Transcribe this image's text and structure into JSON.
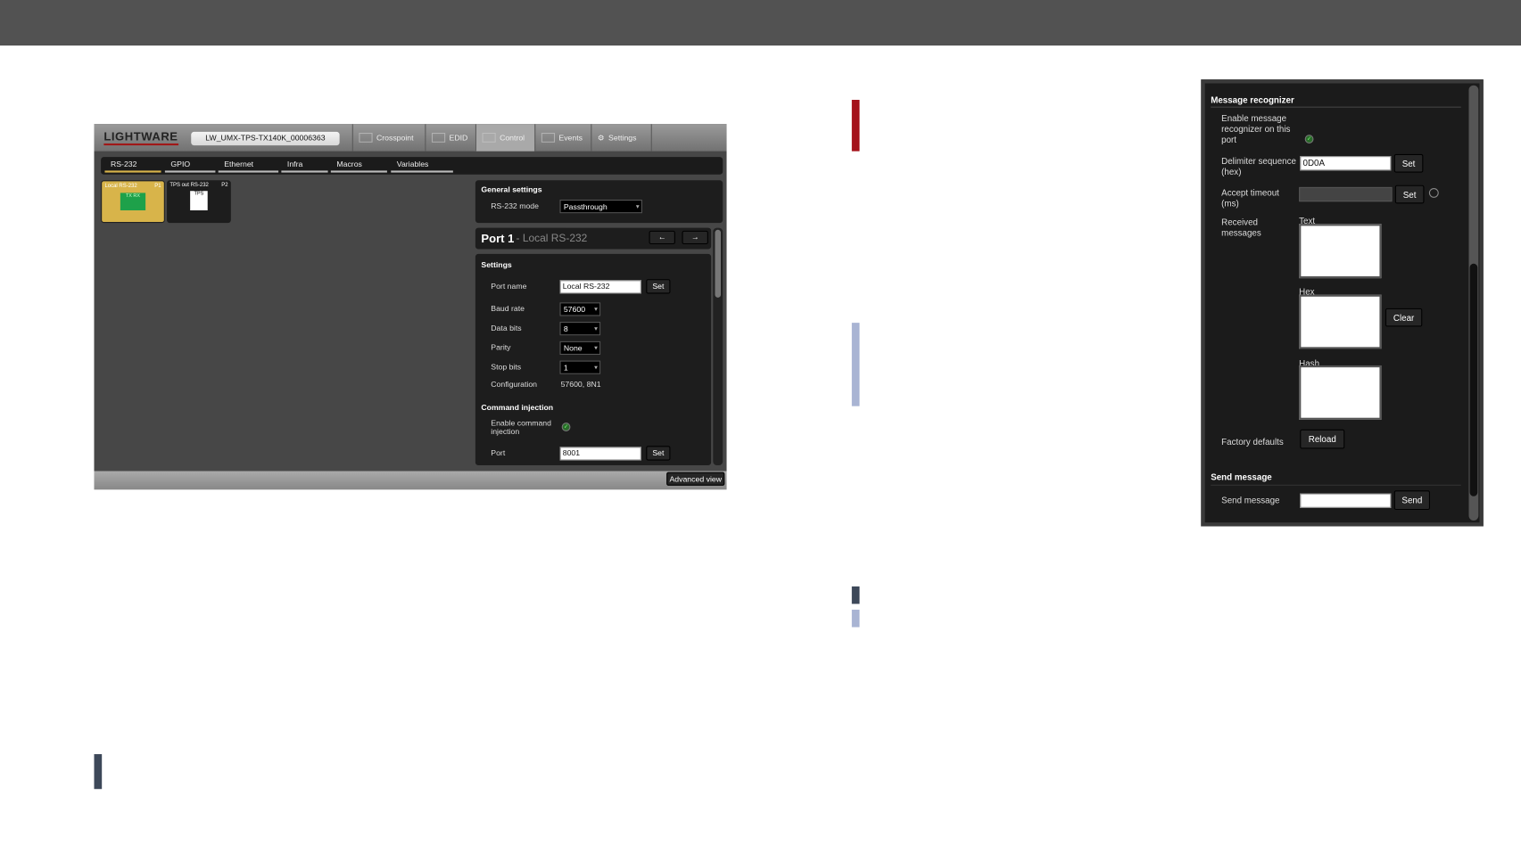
{
  "app": {
    "logo": "LIGHTWARE",
    "device_name": "LW_UMX-TPS-TX140K_00006363",
    "nav": [
      {
        "label": "Crosspoint",
        "icon": "crosspoint-icon"
      },
      {
        "label": "EDID",
        "icon": "monitor-icon"
      },
      {
        "label": "Control",
        "icon": "control-icon",
        "active": true
      },
      {
        "label": "Events",
        "icon": "events-icon"
      },
      {
        "label": "Settings",
        "icon": "gear-icon"
      }
    ],
    "subtabs": [
      {
        "label": "RS-232",
        "active": true
      },
      {
        "label": "GPIO"
      },
      {
        "label": "Ethernet"
      },
      {
        "label": "Infra"
      },
      {
        "label": "Macros"
      },
      {
        "label": "Variables"
      }
    ],
    "ports": [
      {
        "name": "Local RS-232",
        "id": "P1",
        "connector": "TX RX",
        "selected": true
      },
      {
        "name": "TPS out RS-232",
        "id": "P2",
        "connector": "TPS"
      }
    ],
    "general": {
      "title": "General settings",
      "mode_label": "RS-232 mode",
      "mode_value": "Passthrough"
    },
    "port_header": {
      "title": "Port 1",
      "subtitle": "- Local RS-232"
    },
    "settings": {
      "title": "Settings",
      "port_name_label": "Port name",
      "port_name_value": "Local RS-232",
      "set": "Set",
      "baud_label": "Baud rate",
      "baud_value": "57600",
      "data_bits_label": "Data bits",
      "data_bits_value": "8",
      "parity_label": "Parity",
      "parity_value": "None",
      "stop_bits_label": "Stop bits",
      "stop_bits_value": "1",
      "config_label": "Configuration",
      "config_value": "57600, 8N1"
    },
    "injection": {
      "title": "Command injection",
      "enable_label": "Enable command injection",
      "enabled": true,
      "port_label": "Port",
      "port_value": "8001",
      "set": "Set"
    },
    "advanced_view": "Advanced view"
  },
  "recognizer": {
    "title": "Message recognizer",
    "enable_label": "Enable message recognizer on this port",
    "enabled": true,
    "delimiter_label": "Delimiter sequence (hex)",
    "delimiter_value": "0D0A",
    "set": "Set",
    "timeout_label": "Accept timeout (ms)",
    "timeout_value": "",
    "received_label": "Received messages",
    "text_label": "Text",
    "hex_label": "Hex",
    "hash_label": "Hash",
    "clear": "Clear",
    "factory_label": "Factory defaults",
    "reload": "Reload",
    "send_title": "Send message",
    "send_label": "Send message",
    "send_value": "",
    "send": "Send"
  },
  "colors": {
    "accent_red": "#a4121b",
    "lavender": "#a9b4d3",
    "slate": "#3d4859",
    "selected_port": "#d8b44a"
  }
}
